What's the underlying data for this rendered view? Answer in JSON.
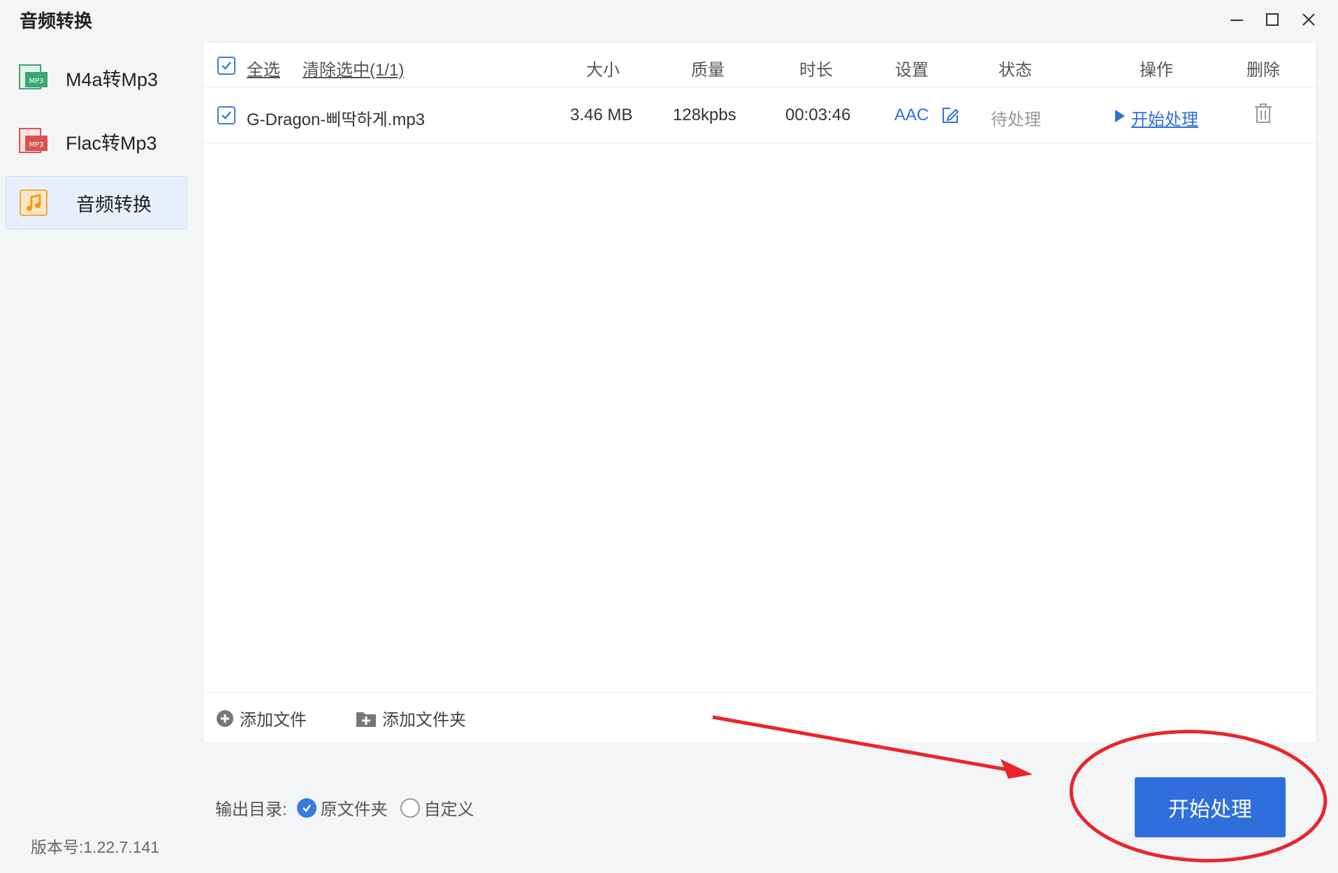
{
  "window": {
    "title": "音频转换"
  },
  "sidebar": {
    "items": [
      {
        "label": "M4a转Mp3",
        "icon": "m4a-to-mp3-icon",
        "active": false
      },
      {
        "label": "Flac转Mp3",
        "icon": "flac-to-mp3-icon",
        "active": false
      },
      {
        "label": "音频转换",
        "icon": "music-note-icon",
        "active": true
      }
    ],
    "version": "版本号:1.22.7.141"
  },
  "table": {
    "select_all_label": "全选",
    "clear_selected_label": "清除选中(1/1)",
    "columns": [
      "大小",
      "质量",
      "时长",
      "设置",
      "状态",
      "操作",
      "删除"
    ],
    "rows": [
      {
        "checked": true,
        "filename": "G-Dragon-삐딱하게.mp3",
        "size": "3.46 MB",
        "quality": "128kpbs",
        "duration": "00:03:46",
        "format": "AAC",
        "status": "待处理",
        "action": "开始处理"
      }
    ]
  },
  "footer": {
    "add_file": "添加文件",
    "add_folder": "添加文件夹"
  },
  "output": {
    "label": "输出目录:",
    "options": [
      {
        "label": "原文件夹",
        "selected": true
      },
      {
        "label": "自定义",
        "selected": false
      }
    ]
  },
  "start_button": "开始处理",
  "colors": {
    "accent": "#2f6fdb",
    "annotation": "#e8262a"
  }
}
